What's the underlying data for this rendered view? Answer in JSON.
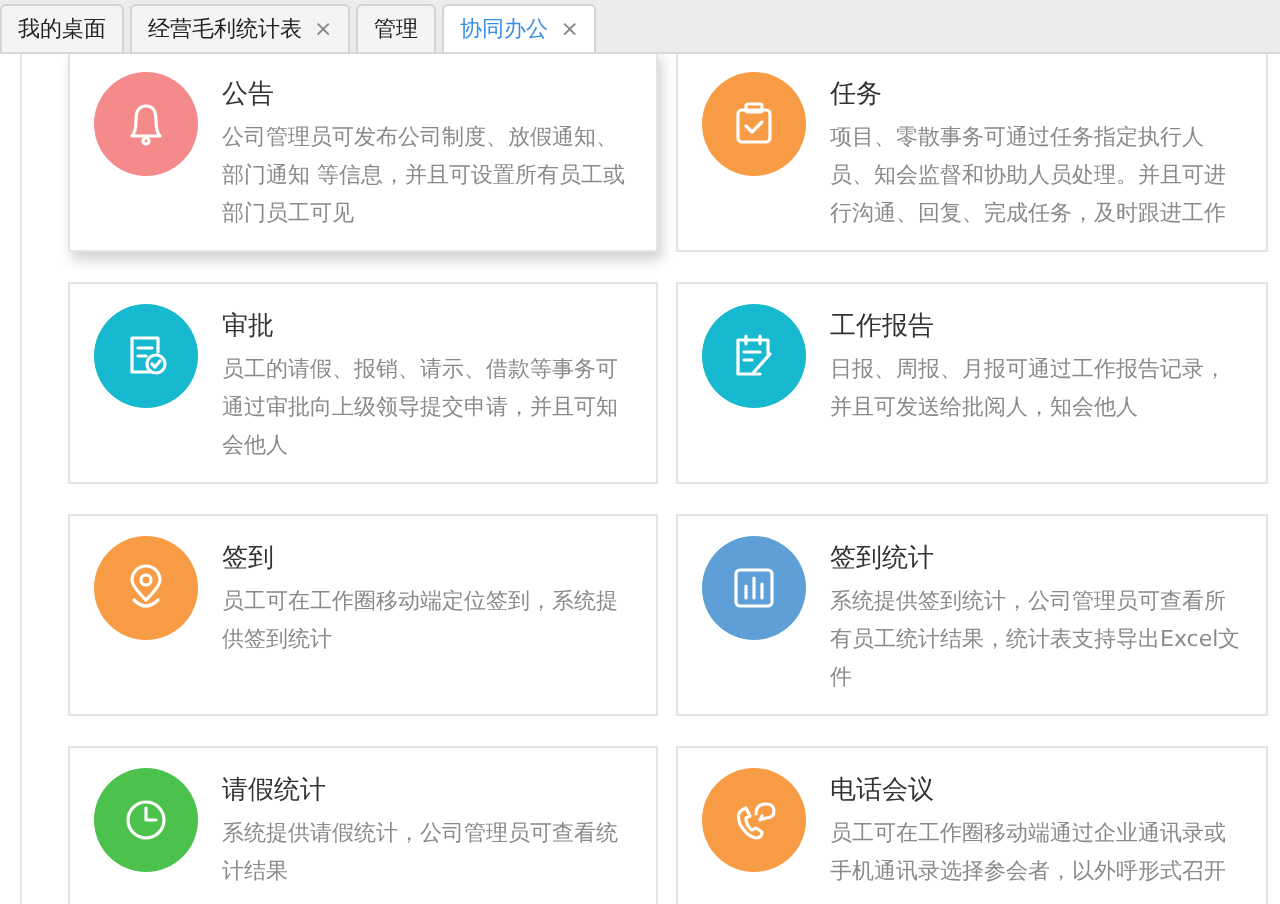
{
  "tabs": [
    {
      "label": "我的桌面",
      "selected": false
    },
    {
      "label": "经营毛利统计表",
      "selected": false,
      "close": "×"
    },
    {
      "label": "管理",
      "selected": false
    },
    {
      "label": "协同办公",
      "selected": true,
      "close": "×"
    }
  ],
  "cards": [
    {
      "title": "公告",
      "description": "公司管理员可发布公司制度、放假通知、部门通知 等信息，并且可设置所有员工或部门员工可见",
      "color": "#f58a8a",
      "raised": true
    },
    {
      "title": "任务",
      "description": "项目、零散事务可通过任务指定执行人员、知会监督和协助人员处理。并且可进行沟通、回复、完成任务，及时跟进工作",
      "color": "#f89b45",
      "raised": false
    },
    {
      "title": "审批",
      "description": "员工的请假、报销、请示、借款等事务可通过审批向上级领导提交申请，并且可知会他人",
      "color": "#16b9cf",
      "raised": false
    },
    {
      "title": "工作报告",
      "description": "日报、周报、月报可通过工作报告记录，并且可发送给批阅人，知会他人",
      "color": "#16b9cf",
      "raised": false
    },
    {
      "title": "签到",
      "description": "员工可在工作圈移动端定位签到，系统提供签到统计",
      "color": "#f89b45",
      "raised": false
    },
    {
      "title": "签到统计",
      "description": "系统提供签到统计，公司管理员可查看所有员工统计结果，统计表支持导出Excel文件",
      "color": "#5f9fd8",
      "raised": false
    },
    {
      "title": "请假统计",
      "description": "系统提供请假统计，公司管理员可查看统计结果",
      "color": "#4cc24c",
      "raised": false
    },
    {
      "title": "电话会议",
      "description": "员工可在工作圈移动端通过企业通讯录或手机通讯录选择参会者，以外呼形式召开",
      "color": "#f89b45",
      "raised": false
    }
  ]
}
